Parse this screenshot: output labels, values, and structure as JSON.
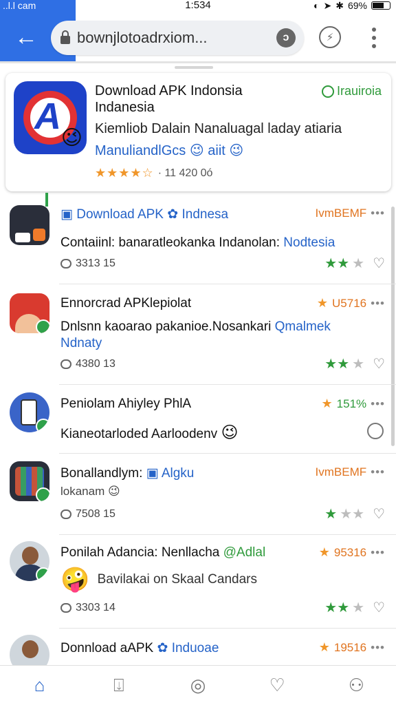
{
  "status_bar": {
    "carrier": "..l.l cam",
    "time": "1:534",
    "battery": "69%"
  },
  "browser": {
    "url": "bownjlotoadrxiom...",
    "back_icon": "back-arrow-icon"
  },
  "featured": {
    "title": "Download APK Indonsia Indanesia",
    "badge": "Irauiroia",
    "description": "Kiemliob Dalain Nanaluagal laday atiaria",
    "link_text": "ManuliandlGcs",
    "emoji_a": "😉",
    "link_suffix": "aiit",
    "emoji_b": "😉",
    "stars": "★★★★☆",
    "rating_text": "· 11 420 0ó"
  },
  "items": [
    {
      "title_prefix": "",
      "title_blue": "Download APK",
      "title_blue_b": "Indnesa",
      "right_label": "IvmBEMF",
      "body": "Contaiinl: banaratleokanka Indanolan:",
      "body_blue": "Nodtesia",
      "count": "3313 15",
      "stars_on": "★★",
      "stars_off": "★"
    },
    {
      "title": "Ennorcrad APKlepiolat",
      "right_label": "U5716",
      "body": "Dnlsnn kaoarao pakanioe.Nosankari",
      "body_blue": "Qmalmek",
      "body2_blue": "Ndnaty",
      "count": "4380 13",
      "stars_on": "★★",
      "stars_off": "★"
    },
    {
      "title": "Peniolam Ahiyley PhlA",
      "right_label": "151%",
      "body": "Kianeotarloded Aarloodenv",
      "emoji": "😉"
    },
    {
      "title": "Bonallandlym:",
      "title_blue": "Algku",
      "right_label": "IvmBEMF",
      "body": "lokanam",
      "emoji": "😉",
      "count": "7508 15",
      "stars_on": "★",
      "stars_off": "★★"
    },
    {
      "title": "Ponilah Adancia: Nenllacha",
      "title_green": "@Adlal",
      "right_label": "95316",
      "emoji": "🤪",
      "body": "Bavilakai on Skaal Candars",
      "count": "3303 14",
      "stars_on": "★★",
      "stars_off": "★"
    },
    {
      "title": "Donnload aAPK",
      "title_blue": "Induoae",
      "right_label": "19516"
    }
  ],
  "bottom_nav": [
    "home-icon",
    "downloads-icon",
    "discover-icon",
    "favorites-icon",
    "profile-icon"
  ],
  "colors": {
    "accent_blue": "#2f6fe4",
    "link_blue": "#2563c8",
    "star_orange": "#f0962a",
    "star_green": "#2f9a3b"
  }
}
